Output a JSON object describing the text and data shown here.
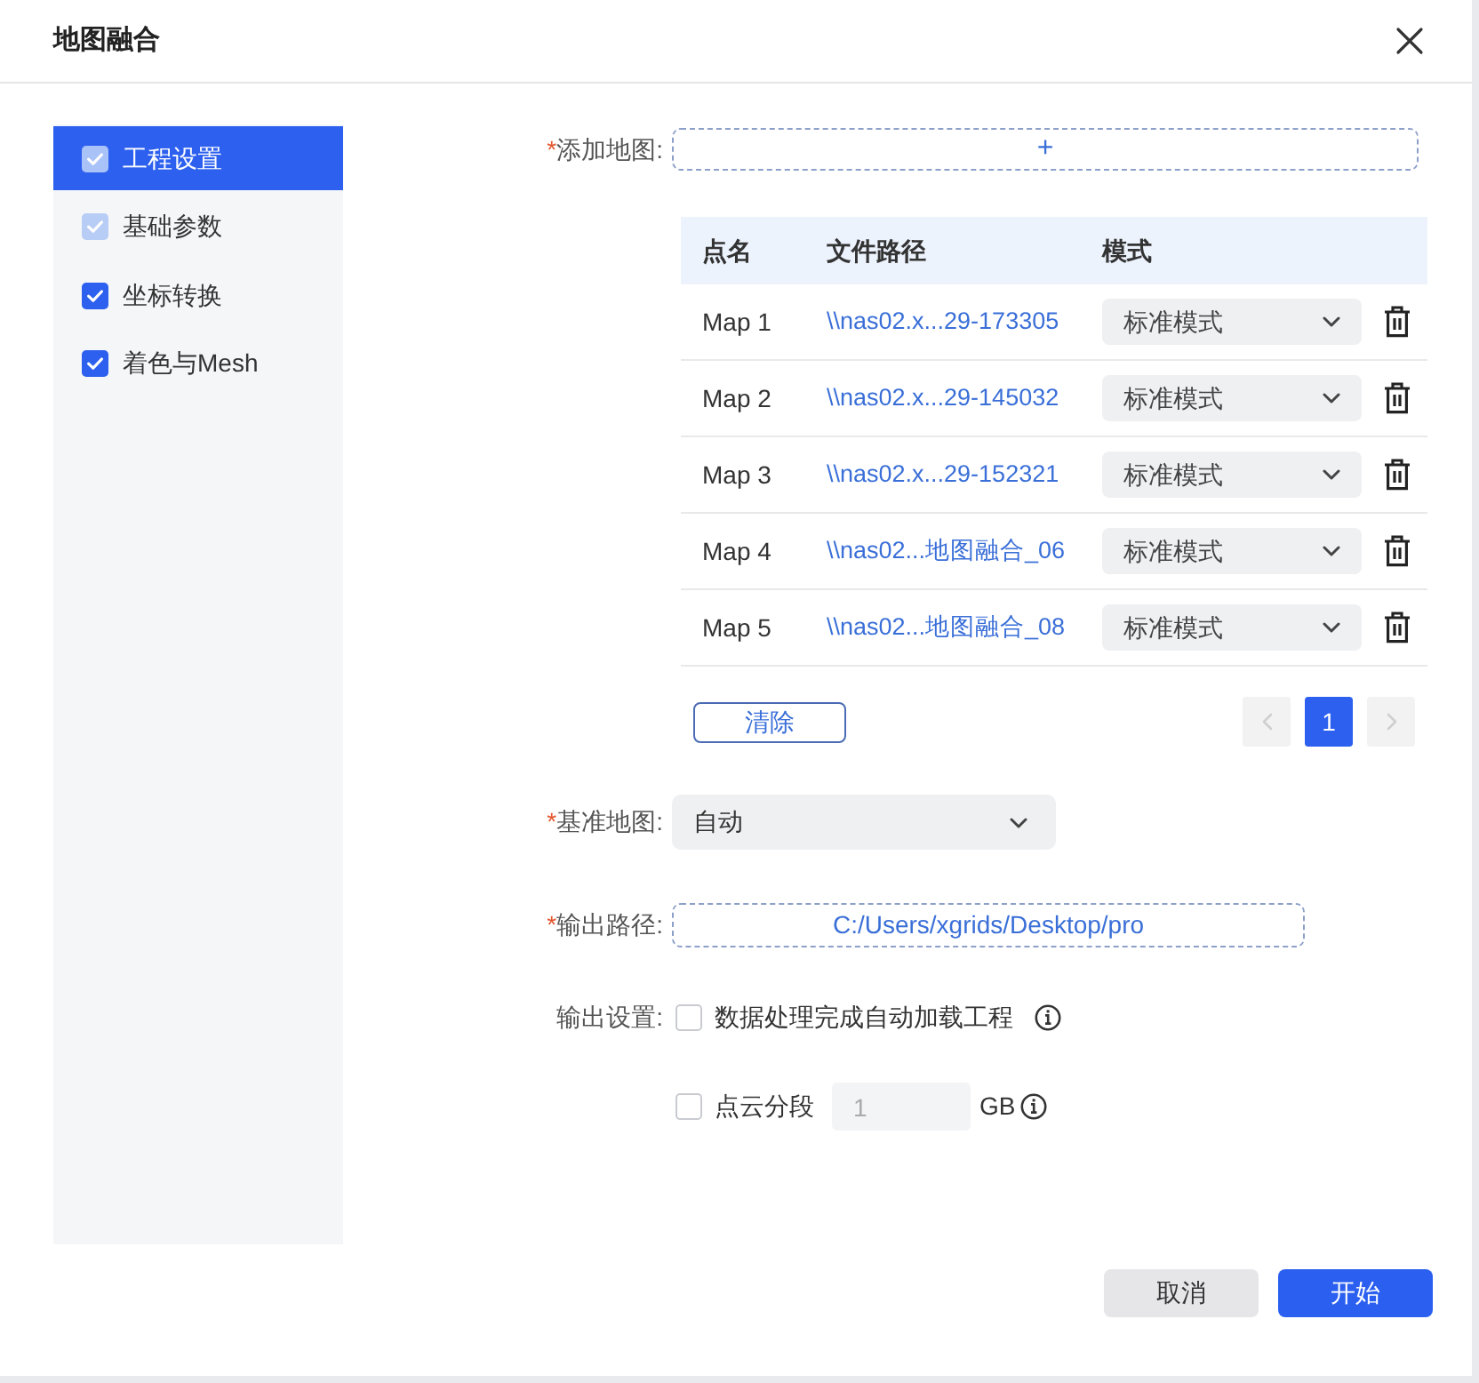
{
  "dialog": {
    "title": "地图融合"
  },
  "sidebar": {
    "items": [
      {
        "label": "工程设置",
        "selected": true,
        "checked": true,
        "disabled": true
      },
      {
        "label": "基础参数",
        "selected": false,
        "checked": true,
        "disabled": true
      },
      {
        "label": "坐标转换",
        "selected": false,
        "checked": true,
        "disabled": false
      },
      {
        "label": "着色与Mesh",
        "selected": false,
        "checked": true,
        "disabled": false
      }
    ]
  },
  "add_map": {
    "required_mark": "*",
    "label": "添加地图:",
    "button": "+"
  },
  "map_table": {
    "columns": [
      "点名",
      "文件路径",
      "模式"
    ],
    "rows": [
      {
        "name": "Map 1",
        "path": "\\\\nas02.x...29-173305",
        "mode": "标准模式"
      },
      {
        "name": "Map 2",
        "path": "\\\\nas02.x...29-145032",
        "mode": "标准模式"
      },
      {
        "name": "Map 3",
        "path": "\\\\nas02.x...29-152321",
        "mode": "标准模式"
      },
      {
        "name": "Map 4",
        "path": "\\\\nas02...地图融合_06",
        "mode": "标准模式"
      },
      {
        "name": "Map 5",
        "path": "\\\\nas02...地图融合_08",
        "mode": "标准模式"
      }
    ]
  },
  "clear_button": "清除",
  "pagination": {
    "prev_disabled": true,
    "pages": [
      {
        "label": "1",
        "selected": true
      }
    ],
    "next_disabled": true
  },
  "base_map": {
    "required_mark": "*",
    "label": "基准地图:",
    "value": "自动"
  },
  "output_path": {
    "required_mark": "*",
    "label": "输出路径:",
    "value": "C:/Users/xgrids/Desktop/pro"
  },
  "output_settings": {
    "label": "输出设置:",
    "options": [
      {
        "kind": "checkbox",
        "label": "数据处理完成自动加载工程",
        "checked": false
      },
      {
        "kind": "segment",
        "label": "点云分段",
        "checked": false,
        "value": "1",
        "value_disabled": true,
        "unit": "GB"
      }
    ]
  },
  "footer": {
    "buttons": [
      {
        "label": "取消",
        "kind": "secondary"
      },
      {
        "label": "开始",
        "kind": "primary"
      }
    ]
  }
}
